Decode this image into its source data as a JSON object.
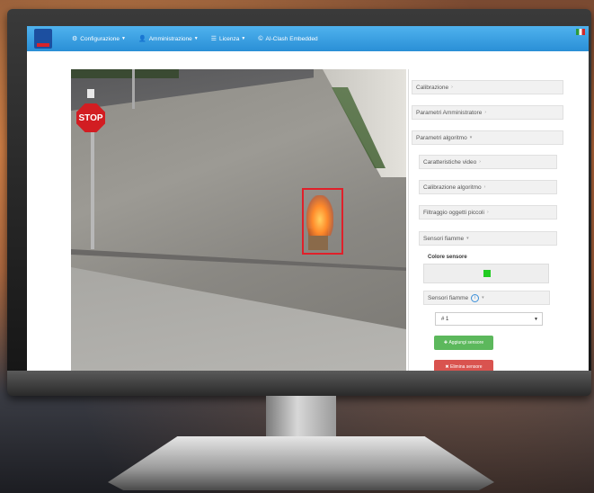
{
  "navbar": {
    "items": [
      {
        "label": "Configurazione",
        "icon": "gear-icon"
      },
      {
        "label": "Amministrazione",
        "icon": "user-icon"
      },
      {
        "label": "Licenza",
        "icon": "list-icon"
      },
      {
        "label": "AI-Clash Embedded",
        "icon": "copyright-icon"
      }
    ]
  },
  "camera": {
    "sign_text": "STOP"
  },
  "panel": {
    "calibrazione": "Calibrazione",
    "parametri_amministratore": "Parametri Amministratore",
    "parametri_algoritmo": "Parametri algoritmo",
    "caratteristiche_video": "Caratteristiche video",
    "calibrazione_algoritmo": "Calibrazione algoritmo",
    "filtraggio": "Filtraggio oggetti piccoli",
    "sensori_fiamme": "Sensori fiamme",
    "colore_sensore": "Colore sensore",
    "sensori_fiamme_sub": "Sensori fiamme",
    "select_value": "# 1",
    "add_button": "Aggiungi sensore",
    "delete_button": "Elimina sensore",
    "sensor_color": "#22cc22"
  }
}
